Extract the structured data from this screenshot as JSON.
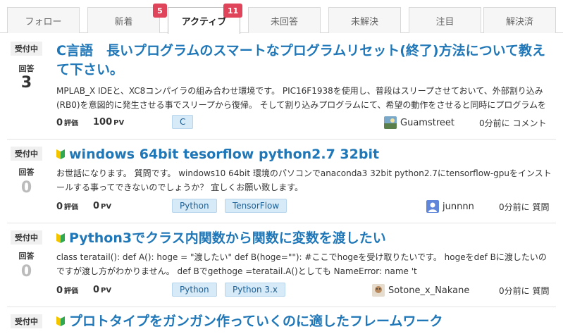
{
  "tabs": [
    {
      "label": "フォロー"
    },
    {
      "label": "新着",
      "badge": "5"
    },
    {
      "label": "アクティブ",
      "badge": "11",
      "active": true
    },
    {
      "label": "未回答"
    },
    {
      "label": "未解決"
    },
    {
      "label": "注目"
    },
    {
      "label": "解決済"
    }
  ],
  "questions": [
    {
      "status": "受付中",
      "answers_label": "回答",
      "answers": "3",
      "title": "C言語　長いプログラムのスマートなプログラムリセット(終了)方法について教えて下さい。",
      "excerpt": "MPLAB_X IDEと、XC8コンパイラの組み合わせ環境です。 PIC16F1938を使用し、普段はスリープさせておいて、外部割り込み(RB0)を意図的に発生させる事でスリープから復帰。 そして割り込みプログラムにて、希望の動作をさせると同時にプログラムをリセット",
      "score": "0",
      "score_unit": "評価",
      "pv": "100",
      "pv_unit": "PV",
      "tags": [
        "C"
      ],
      "user": "Guamstreet",
      "ago": "0分前に コメント"
    },
    {
      "status": "受付中",
      "answers_label": "回答",
      "answers": "0",
      "title": "windows 64bit tesorflow python2.7 32bit",
      "excerpt": "お世話になります。 質問です。 windows10 64bit 環境のパソコンでanaconda3 32bit python2.7にtensorflow-gpuをインストールする事ってできないのでしょうか？ 宜しくお願い致します。",
      "score": "0",
      "score_unit": "評価",
      "pv": "0",
      "pv_unit": "PV",
      "tags": [
        "Python",
        "TensorFlow"
      ],
      "user": "junnnn",
      "ago": "0分前に 質問"
    },
    {
      "status": "受付中",
      "answers_label": "回答",
      "answers": "0",
      "title": "Python3でクラス内関数から関数に変数を渡したい",
      "excerpt": "class teratail(): def A(): hoge = \"渡したい\" def B(hoge=\"\"): #ここでhogeを受け取りたいです。 hogeをdef Bに渡したいのですが渡し方がわかりません。 def Bでgethoge =teratail.A()としても NameError: name 't",
      "score": "0",
      "score_unit": "評価",
      "pv": "0",
      "pv_unit": "PV",
      "tags": [
        "Python",
        "Python 3.x"
      ],
      "user": "Sotone_x_Nakane",
      "ago": "0分前に 質問"
    },
    {
      "status": "受付中",
      "title": "プロトタイプをガンガン作っていくのに適したフレームワーク"
    }
  ],
  "colors": {
    "link": "#1f77b8",
    "badge": "#e0445a",
    "tag_bg": "#d7eaf7"
  }
}
